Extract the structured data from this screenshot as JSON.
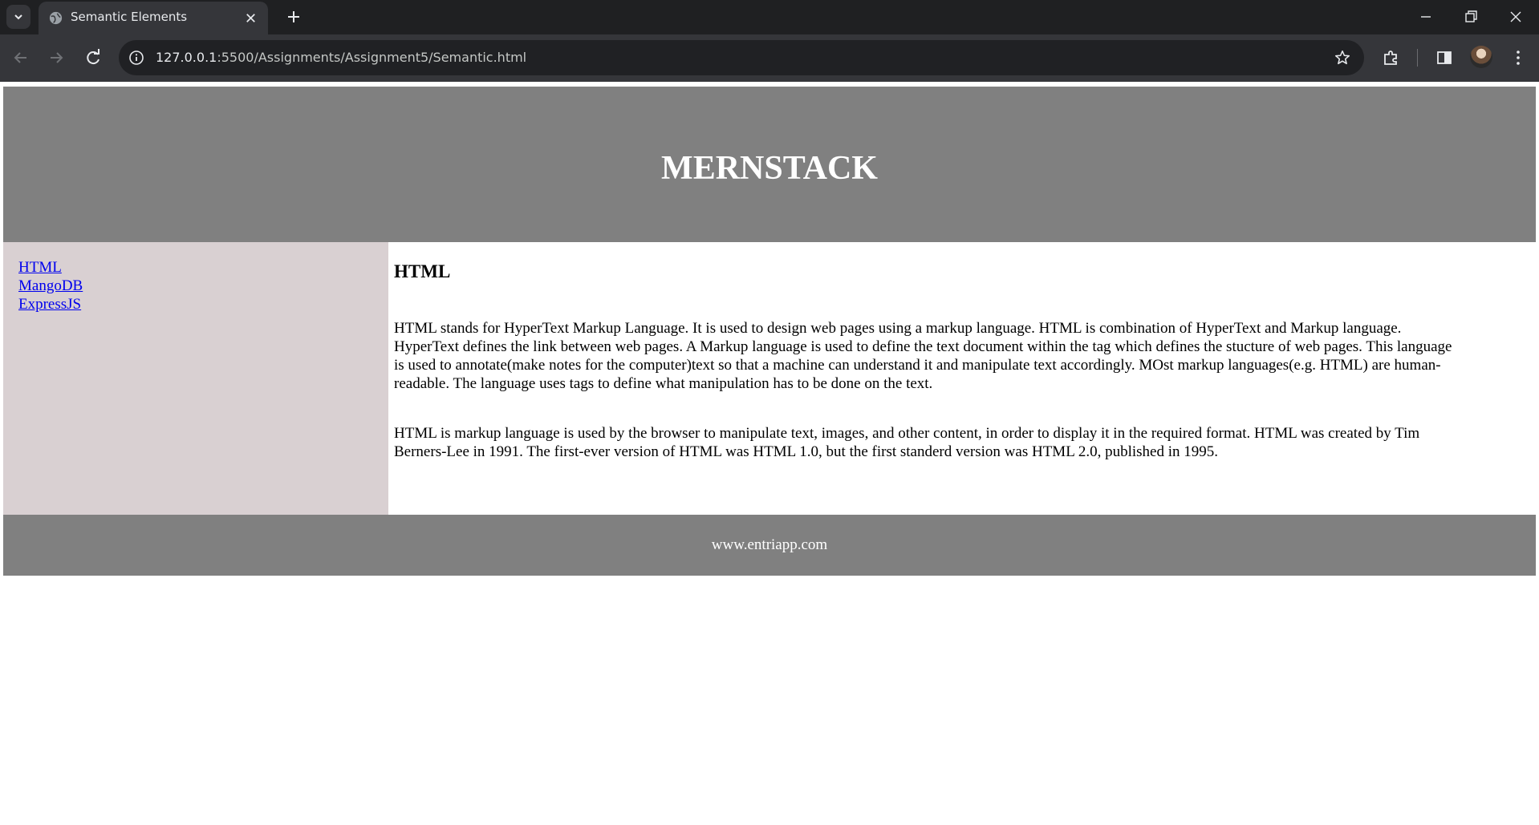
{
  "browser": {
    "tab_title": "Semantic Elements",
    "url_host": "127.0.0.1",
    "url_rest": ":5500/Assignments/Assignment5/Semantic.html"
  },
  "page": {
    "header_title": "MERNSTACK",
    "nav": [
      "HTML",
      "MangoDB",
      "ExpressJS"
    ],
    "article_heading": "HTML",
    "paragraph_1": "HTML stands for HyperText Markup Language. It is used to design web pages using a markup language. HTML is combination of HyperText and Markup language. HyperText defines the link between web pages. A Markup language is used to define the text document within the tag which defines the stucture of web pages. This language is used to annotate(make notes for the computer)text so that a machine can understand it and manipulate text accordingly. MOst markup languages(e.g. HTML) are human-readable. The language uses tags to define what manipulation has to be done on the text.",
    "paragraph_2": "HTML is markup language is used by the browser to manipulate text, images, and other content, in order to display it in the required format. HTML was created by Tim Berners-Lee in 1991. The first-ever version of HTML was HTML 1.0, but the first standerd version was HTML 2.0, published in 1995.",
    "footer": "www.entriapp.com"
  },
  "colors": {
    "header_bg": "#808080",
    "sidebar_bg": "#d9d0d2",
    "link": "#0000ee"
  }
}
